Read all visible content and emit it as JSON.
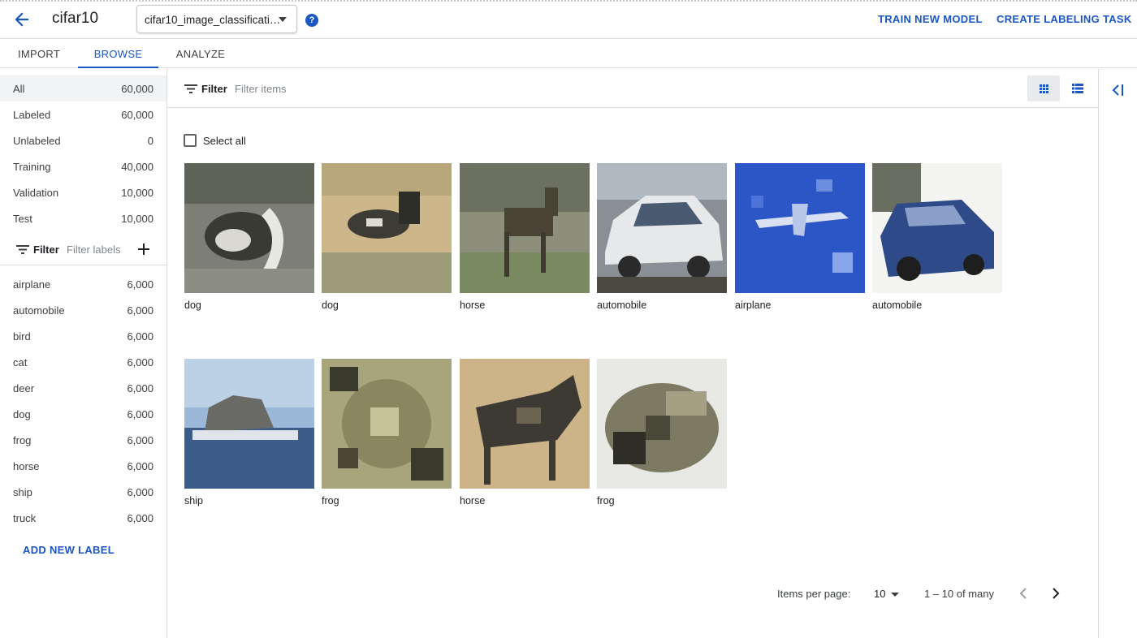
{
  "header": {
    "title": "cifar10",
    "model_select": "cifar10_image_classificati…",
    "train_label": "TRAIN NEW MODEL",
    "labeling_label": "CREATE LABELING TASK",
    "help_glyph": "?"
  },
  "tabs": [
    {
      "label": "IMPORT"
    },
    {
      "label": "BROWSE",
      "active": true
    },
    {
      "label": "ANALYZE"
    }
  ],
  "splits": [
    {
      "name": "All",
      "count": "60,000"
    },
    {
      "name": "Labeled",
      "count": "60,000"
    },
    {
      "name": "Unlabeled",
      "count": "0"
    },
    {
      "name": "Training",
      "count": "40,000"
    },
    {
      "name": "Validation",
      "count": "10,000"
    },
    {
      "name": "Test",
      "count": "10,000"
    }
  ],
  "label_filter": {
    "label": "Filter",
    "placeholder": "Filter labels"
  },
  "labels": [
    {
      "name": "airplane",
      "count": "6,000"
    },
    {
      "name": "automobile",
      "count": "6,000"
    },
    {
      "name": "bird",
      "count": "6,000"
    },
    {
      "name": "cat",
      "count": "6,000"
    },
    {
      "name": "deer",
      "count": "6,000"
    },
    {
      "name": "dog",
      "count": "6,000"
    },
    {
      "name": "frog",
      "count": "6,000"
    },
    {
      "name": "horse",
      "count": "6,000"
    },
    {
      "name": "ship",
      "count": "6,000"
    },
    {
      "name": "truck",
      "count": "6,000"
    }
  ],
  "add_label": "ADD NEW LABEL",
  "item_filter": {
    "label": "Filter",
    "placeholder": "Filter items"
  },
  "select_all": "Select all",
  "items": [
    {
      "label": "dog"
    },
    {
      "label": "dog"
    },
    {
      "label": "horse"
    },
    {
      "label": "automobile"
    },
    {
      "label": "airplane"
    },
    {
      "label": "automobile"
    },
    {
      "label": "ship"
    },
    {
      "label": "frog"
    },
    {
      "label": "horse"
    },
    {
      "label": "frog"
    }
  ],
  "pagination": {
    "items_per_page_label": "Items per page:",
    "page_size": "10",
    "range": "1 – 10 of many"
  },
  "colors": {
    "accent": "#1a56c4",
    "divider": "#dadce0"
  },
  "icons": [
    "back-arrow-icon",
    "dropdown-caret-icon",
    "help-icon",
    "filter-icon",
    "add-icon",
    "grid-view-icon",
    "list-view-icon",
    "collapse-panel-icon",
    "chevron-left-icon",
    "chevron-right-icon"
  ]
}
